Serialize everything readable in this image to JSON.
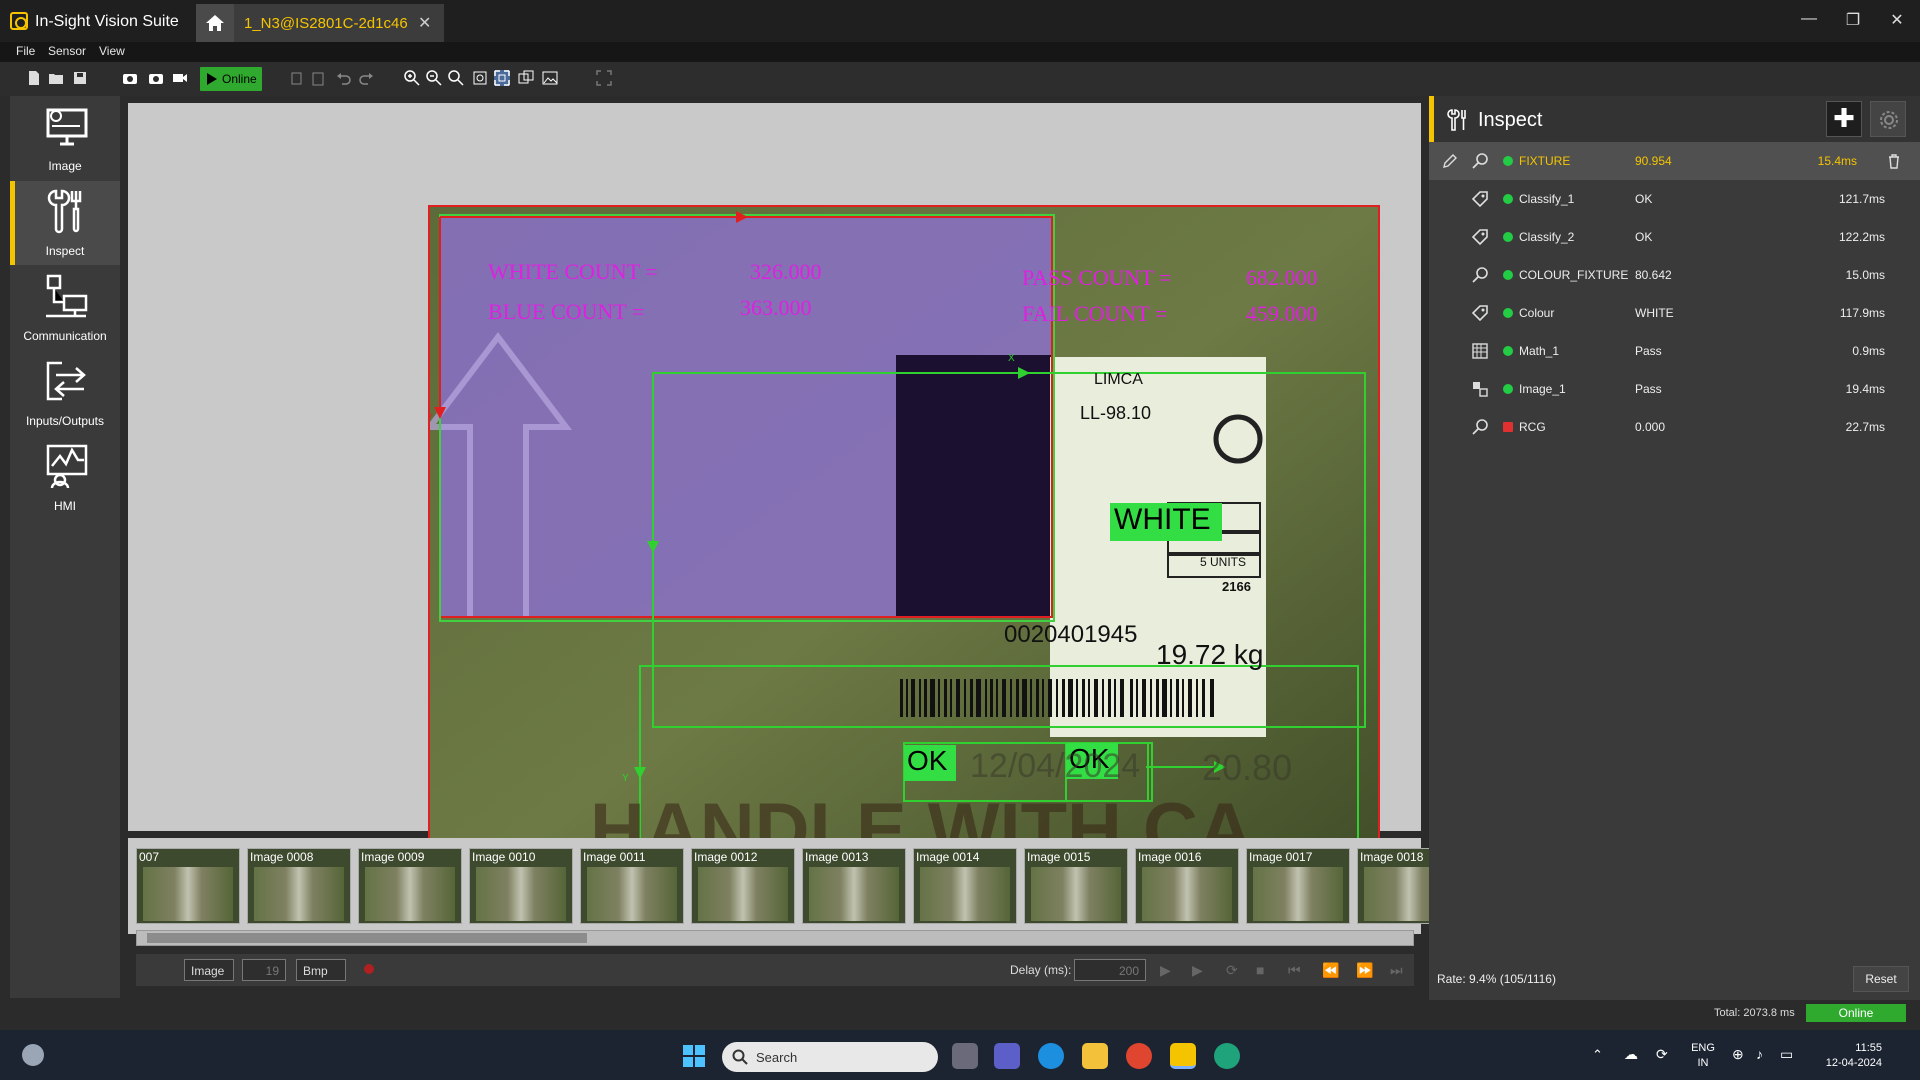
{
  "app": {
    "title": "In-Sight Vision Suite",
    "doc_tab": "1_N3@IS2801C-2d1c46",
    "close_glyph": "✕"
  },
  "window": {
    "min": "—",
    "max": "❐",
    "close": "✕"
  },
  "menu": [
    "File",
    "Sensor",
    "View"
  ],
  "toolbar": {
    "online_label": "Online"
  },
  "nav": [
    {
      "label": "Image",
      "icon": "image-monitor-icon"
    },
    {
      "label": "Inspect",
      "icon": "tools-icon"
    },
    {
      "label": "Communication",
      "icon": "network-icon"
    },
    {
      "label": "Inputs/Outputs",
      "icon": "io-arrows-icon"
    },
    {
      "label": "HMI",
      "icon": "hmi-icon"
    }
  ],
  "overlay": {
    "white_count_label": "WHITE COUNT =",
    "white_count_value": "326.000",
    "blue_count_label": "BLUE COUNT =",
    "blue_count_value": "363.000",
    "pass_count_label": "PASS COUNT =",
    "pass_count_value": "682.000",
    "fail_count_label": "FAIL COUNT =",
    "fail_count_value": "459.000",
    "colour_result": "WHITE",
    "ok_1": "OK",
    "ok_2": "OK",
    "label_number": "0020401945",
    "label_weight": "19.72 kg",
    "label_brand": "LIMCA",
    "label_code": "LL-98.10",
    "label_units": "5 UNITS",
    "label_mrc": "2166",
    "carton_text": "HANDLE WITH CA",
    "carton_date": "12/04/2024",
    "carton_price": "20.80",
    "axis_x": "X",
    "axis_y": "Y"
  },
  "filmstrip": {
    "thumbs": [
      "007",
      "Image 0008",
      "Image 0009",
      "Image 0010",
      "Image 0011",
      "Image 0012",
      "Image 0013",
      "Image 0014",
      "Image 0015",
      "Image 0016",
      "Image 0017",
      "Image 0018"
    ]
  },
  "playbar": {
    "source": "Image",
    "index": "19",
    "format": "Bmp",
    "delay_label": "Delay (ms):",
    "delay_value": "200"
  },
  "inspect": {
    "title": "Inspect",
    "add_glyph": "✚",
    "rows": [
      {
        "name": "FIXTURE",
        "value": "90.954",
        "time": "15.4ms",
        "status": "pass",
        "icon": "fixture-icon",
        "selected": true
      },
      {
        "name": "Classify_1",
        "value": "OK",
        "time": "121.7ms",
        "status": "pass",
        "icon": "tag-icon",
        "selected": false
      },
      {
        "name": "Classify_2",
        "value": "OK",
        "time": "122.2ms",
        "status": "pass",
        "icon": "tag-icon",
        "selected": false
      },
      {
        "name": "COLOUR_FIXTURE",
        "value": "80.642",
        "time": "15.0ms",
        "status": "pass",
        "icon": "fixture-icon",
        "selected": false
      },
      {
        "name": "Colour",
        "value": "WHITE",
        "time": "117.9ms",
        "status": "pass",
        "icon": "tag-icon",
        "selected": false
      },
      {
        "name": "Math_1",
        "value": "Pass",
        "time": "0.9ms",
        "status": "pass",
        "icon": "math-grid-icon",
        "selected": false
      },
      {
        "name": "Image_1",
        "value": "Pass",
        "time": "19.4ms",
        "status": "pass",
        "icon": "image-tool-icon",
        "selected": false
      },
      {
        "name": "RCG",
        "value": "0.000",
        "time": "22.7ms",
        "status": "fail",
        "icon": "fixture-icon",
        "selected": false
      }
    ],
    "rate": "Rate: 9.4% (105/1116)",
    "reset": "Reset"
  },
  "status": {
    "total": "Total: 2073.8 ms",
    "online": "Online"
  },
  "taskbar": {
    "search": "Search",
    "lang_1": "ENG",
    "lang_2": "IN",
    "time": "11:55",
    "date": "12-04-2024"
  },
  "colors": {
    "accent": "#f5c400",
    "pass": "#22cc44",
    "fail": "#e03030",
    "online": "#2faa2f",
    "overlay_magenta": "#e020e0",
    "roi_green": "#30d030",
    "roi_red": "#e02020"
  }
}
